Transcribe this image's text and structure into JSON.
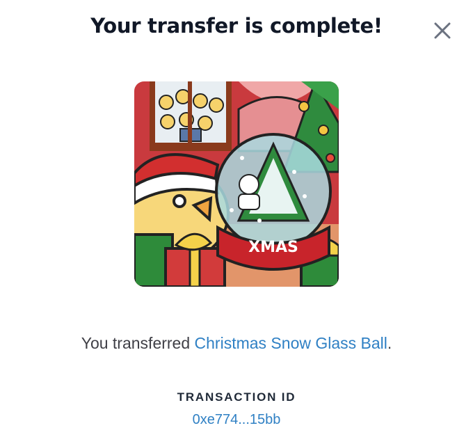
{
  "dialog": {
    "title": "Your transfer is complete!",
    "close_icon": "close-icon"
  },
  "nft": {
    "image_icon": "christmas-snow-glass-ball-art",
    "globe_text": "XMAS"
  },
  "message": {
    "prefix": "You transferred ",
    "item_name": "Christmas Snow Glass Ball",
    "suffix": "."
  },
  "transaction": {
    "label": "TRANSACTION ID",
    "id": "0xe774...15bb"
  },
  "colors": {
    "link": "#2f80c4",
    "title": "#111827",
    "text": "#3f3f46"
  }
}
